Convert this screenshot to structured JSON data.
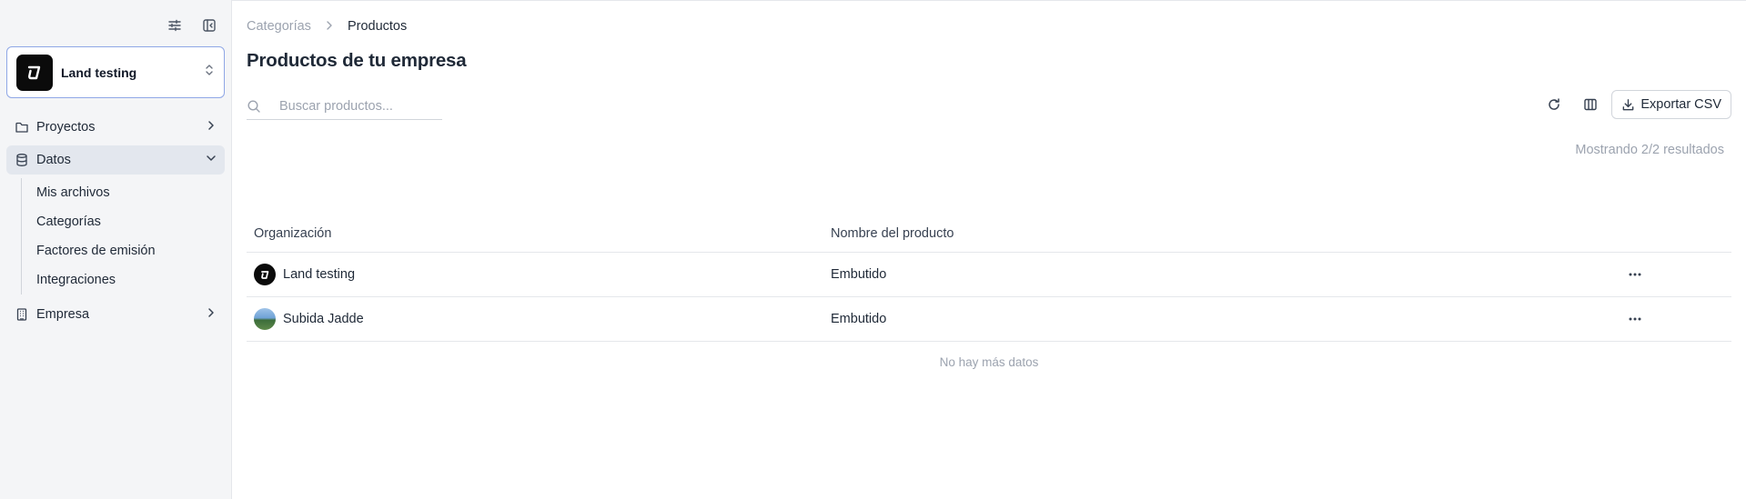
{
  "sidebar": {
    "org_name": "Land testing",
    "nav": [
      {
        "label": "Proyectos",
        "icon": "folder-icon"
      },
      {
        "label": "Datos",
        "icon": "database-icon",
        "active": true
      },
      {
        "label": "Empresa",
        "icon": "building-icon"
      }
    ],
    "datos_subitems": [
      "Mis archivos",
      "Categorías",
      "Factores de emisión",
      "Integraciones"
    ]
  },
  "breadcrumb": {
    "parent": "Categorías",
    "current": "Productos"
  },
  "page": {
    "title": "Productos de tu empresa"
  },
  "search": {
    "placeholder": "Buscar productos...",
    "value": ""
  },
  "toolbar": {
    "export_label": "Exportar CSV"
  },
  "results_text": "Mostrando 2/2 resultados",
  "table": {
    "headers": [
      "Organización",
      "Nombre del producto"
    ],
    "rows": [
      {
        "organization": "Land testing",
        "product": "Embutido"
      },
      {
        "organization": "Subida Jadde",
        "product": "Embutido"
      }
    ],
    "footer": "No hay más datos"
  },
  "colors": {
    "accent_border": "#8fa7e6",
    "sidebar_bg": "#f4f5f7",
    "active_nav_bg": "#e3e7ee"
  }
}
